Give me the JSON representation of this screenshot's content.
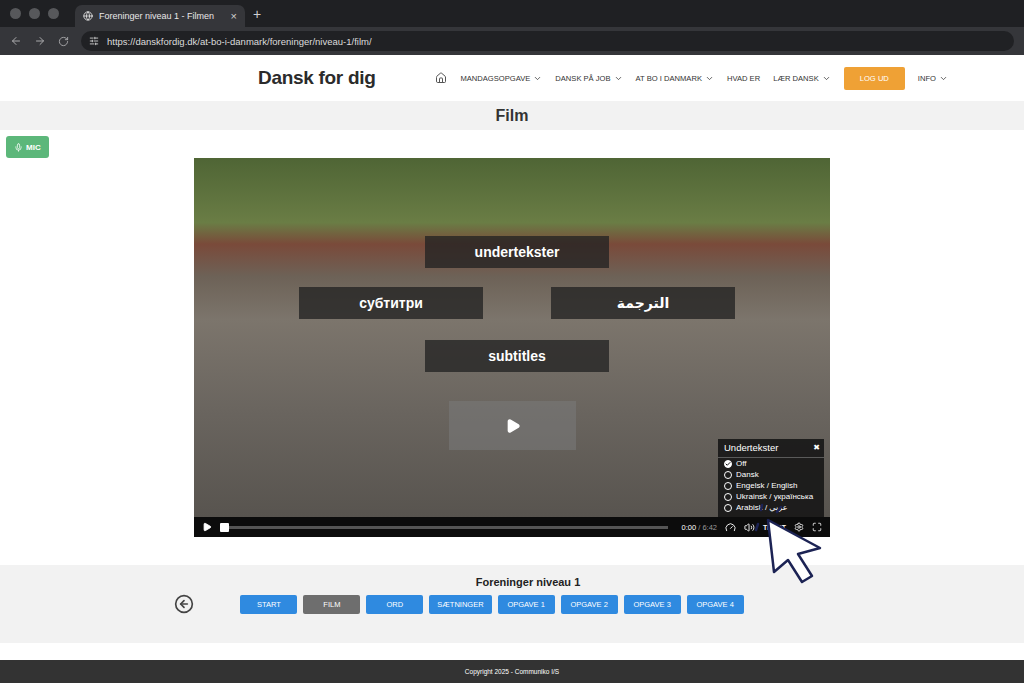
{
  "browser": {
    "tab": {
      "title": "Foreninger niveau 1 - Filmen",
      "close": "×"
    },
    "new_tab": "+",
    "url": "https://danskfordig.dk/at-bo-i-danmark/foreninger/niveau-1/film/"
  },
  "site": {
    "logo": "Dansk for dig",
    "nav": [
      {
        "label": "MANDAGSOPGAVE",
        "kind": "link",
        "dropdown": true
      },
      {
        "label": "DANSK PÅ JOB",
        "kind": "link",
        "dropdown": true
      },
      {
        "label": "AT BO I DANMARK",
        "kind": "link",
        "dropdown": true
      },
      {
        "label": "HVAD ER",
        "kind": "link",
        "dropdown": false
      },
      {
        "label": "LÆR DANSK",
        "kind": "link",
        "dropdown": true
      },
      {
        "label": "LOG UD",
        "kind": "button",
        "dropdown": false
      },
      {
        "label": "INFO",
        "kind": "link",
        "dropdown": true
      }
    ]
  },
  "page_title": "Film",
  "mic_button": "MIC",
  "video": {
    "caption_badges": [
      "undertekster",
      "субтитри",
      "الترجمة",
      "subtitles"
    ],
    "progress": 0,
    "time": "0:00",
    "separator": "/",
    "duration": "6:42",
    "text_button": "TEKST",
    "subtitles_menu": {
      "title": "Undertekster",
      "close": "✖",
      "options": [
        {
          "label": "Off",
          "selected": true
        },
        {
          "label": "Dansk",
          "selected": false
        },
        {
          "label": "Engelsk / English",
          "selected": false
        },
        {
          "label": "Ukrainsk / українська",
          "selected": false
        },
        {
          "label": "Arabisk / عربي",
          "selected": false
        }
      ]
    }
  },
  "lesson_nav": {
    "title": "Foreninger niveau 1",
    "buttons": [
      {
        "label": "START",
        "selected": false
      },
      {
        "label": "FILM",
        "selected": true
      },
      {
        "label": "ORD",
        "selected": false
      },
      {
        "label": "SÆTNINGER",
        "selected": false
      },
      {
        "label": "OPGAVE 1",
        "selected": false
      },
      {
        "label": "OPGAVE 2",
        "selected": false
      },
      {
        "label": "OPGAVE 3",
        "selected": false
      },
      {
        "label": "OPGAVE 4",
        "selected": false
      }
    ]
  },
  "footer": "Copyright 2025 - Communiko I/S"
}
